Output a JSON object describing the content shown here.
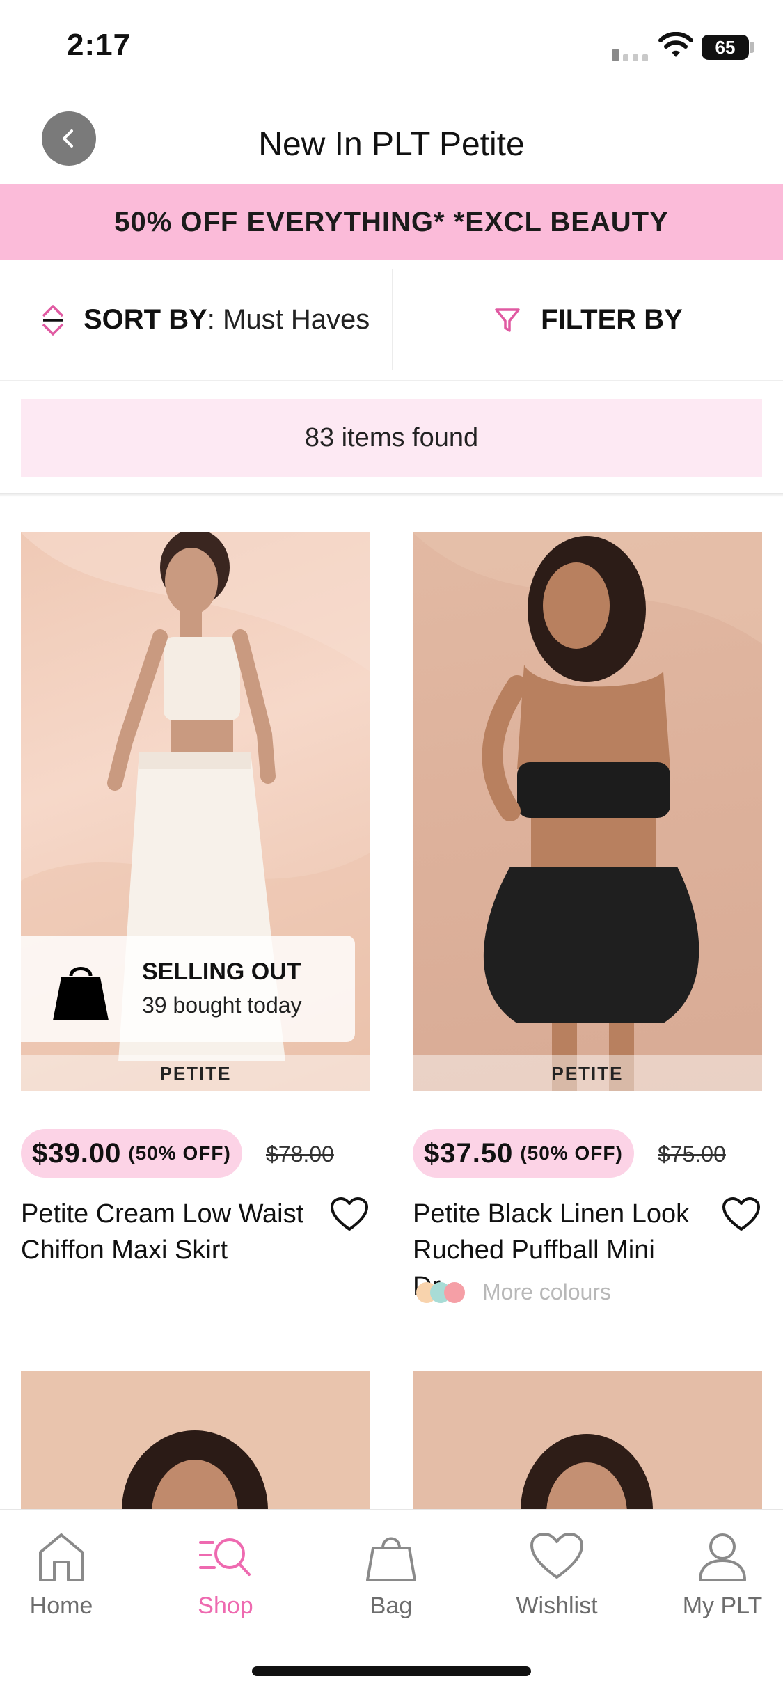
{
  "status_bar": {
    "time": "2:17",
    "battery": "65"
  },
  "header": {
    "title": "New In PLT Petite"
  },
  "promo": {
    "text": "50% OFF EVERYTHING* *EXCL BEAUTY"
  },
  "sort": {
    "label": "SORT BY",
    "value": ": Must Haves"
  },
  "filter": {
    "label": "FILTER BY"
  },
  "results": {
    "count_text": "83 items found"
  },
  "products": [
    {
      "tag": "PETITE",
      "badge_title": "SELLING OUT",
      "badge_sub": "39 bought today",
      "price": "$39.00",
      "discount": "(50% OFF)",
      "old_price": "$78.00",
      "name_line1": "Petite Cream Low Waist",
      "name_line2": "Chiffon Maxi Skirt"
    },
    {
      "tag": "PETITE",
      "price": "$37.50",
      "discount": "(50% OFF)",
      "old_price": "$75.00",
      "name_line1": "Petite Black Linen Look",
      "name_line2": "Ruched Puffball Mini Dr...",
      "more_colours": "More colours"
    }
  ],
  "nav": {
    "items": [
      {
        "label": "Home",
        "icon": "home-icon"
      },
      {
        "label": "Shop",
        "icon": "shop-search-icon",
        "active": true
      },
      {
        "label": "Bag",
        "icon": "bag-icon"
      },
      {
        "label": "Wishlist",
        "icon": "heart-icon"
      },
      {
        "label": "My PLT",
        "icon": "user-icon"
      }
    ]
  },
  "colors": {
    "accent_pink": "#ee6ab0",
    "promo_bg": "#fbbbd9",
    "price_pill": "#fcd3e6"
  }
}
